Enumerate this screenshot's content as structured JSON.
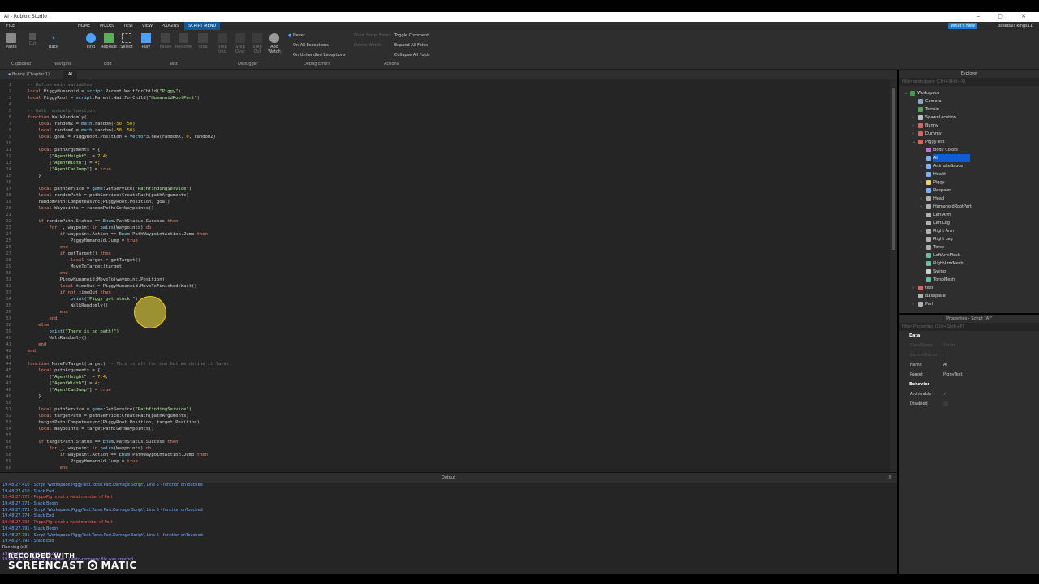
{
  "window": {
    "title": "AI - Roblox Studio",
    "controls": "– ▢ ✕"
  },
  "menubar": {
    "file": "FILE",
    "items": [
      "HOME",
      "MODEL",
      "TEST",
      "VIEW",
      "PLUGINS",
      "SCRIPT MENU"
    ],
    "whats_new": "What's New",
    "user": "baseball_kings11"
  },
  "ribbon": {
    "buttons": [
      "Paste",
      "Cut",
      "Copy",
      "Back",
      "Find",
      "Replace",
      "Select",
      "Play",
      "Pause",
      "Resume",
      "Stop",
      "Step Into",
      "Step Over",
      "Step Out",
      "Add Watch"
    ],
    "groups": [
      "Clipboard",
      "Navigate",
      "Edit",
      "Test",
      "Debugger",
      "Debug Errors",
      "Actions"
    ],
    "debug_errors": [
      "Never",
      "On All Exceptions",
      "On Unhandled Exceptions"
    ],
    "actions_dim": [
      "Show Script Errors",
      "Delete Watch"
    ],
    "actions": [
      "Toggle Comment",
      "Expand All Folds",
      "Collapse All Folds"
    ]
  },
  "tabs": [
    "Bunny (Chapter 1)",
    "AI"
  ],
  "code": {
    "lines": [
      [
        [
          "cm",
          "-- Define main variables"
        ]
      ],
      [
        [
          "kw",
          "local "
        ],
        [
          "",
          "PiggyHumanoid = "
        ],
        [
          "bi",
          "script"
        ],
        [
          "",
          ".Parent:WaitForChild("
        ],
        [
          "st",
          "\"Piggy\""
        ],
        [
          "",
          ")"
        ]
      ],
      [
        [
          "kw",
          "local "
        ],
        [
          "",
          "PiggyRoot = "
        ],
        [
          "bi",
          "script"
        ],
        [
          "",
          ".Parent:WaitForChild("
        ],
        [
          "st",
          "\"HumanoidRootPart\""
        ],
        [
          "",
          ")"
        ]
      ],
      [
        [
          "",
          ""
        ]
      ],
      [
        [
          "cm",
          "-- Walk randomly function"
        ]
      ],
      [
        [
          "kw",
          "function "
        ],
        [
          "",
          "WalkRandomly()"
        ]
      ],
      [
        [
          "",
          "    "
        ],
        [
          "kw",
          "local "
        ],
        [
          "",
          "randomZ = "
        ],
        [
          "bi",
          "math"
        ],
        [
          "",
          ".random(-"
        ],
        [
          "nm",
          "50"
        ],
        [
          "",
          ", "
        ],
        [
          "nm",
          "50"
        ],
        [
          "",
          ")"
        ]
      ],
      [
        [
          "",
          "    "
        ],
        [
          "kw",
          "local "
        ],
        [
          "",
          "randomX = "
        ],
        [
          "bi",
          "math"
        ],
        [
          "",
          ".random(-"
        ],
        [
          "nm",
          "50"
        ],
        [
          "",
          ", "
        ],
        [
          "nm",
          "50"
        ],
        [
          "",
          ")"
        ]
      ],
      [
        [
          "",
          "    "
        ],
        [
          "kw",
          "local "
        ],
        [
          "",
          "goal = PiggyRoot.Position + "
        ],
        [
          "bi",
          "Vector3"
        ],
        [
          "",
          ".new(randomX, "
        ],
        [
          "nm",
          "0"
        ],
        [
          "",
          ", randomZ)"
        ]
      ],
      [
        [
          "",
          ""
        ]
      ],
      [
        [
          "",
          "    "
        ],
        [
          "kw",
          "local "
        ],
        [
          "",
          "pathArguments = {"
        ]
      ],
      [
        [
          "",
          "        ["
        ],
        [
          "st",
          "\"AgentHeight\""
        ],
        [
          "",
          "] = "
        ],
        [
          "nm",
          "7.4"
        ],
        [
          "",
          ";"
        ]
      ],
      [
        [
          "",
          "        ["
        ],
        [
          "st",
          "\"AgentWidth\""
        ],
        [
          "",
          "] = "
        ],
        [
          "nm",
          "4"
        ],
        [
          "",
          ";"
        ]
      ],
      [
        [
          "",
          "        ["
        ],
        [
          "st",
          "\"AgentCanJump\""
        ],
        [
          "",
          "] = "
        ],
        [
          "kw",
          "true"
        ]
      ],
      [
        [
          "",
          "    }"
        ]
      ],
      [
        [
          "",
          ""
        ]
      ],
      [
        [
          "",
          "    "
        ],
        [
          "kw",
          "local "
        ],
        [
          "",
          "pathService = "
        ],
        [
          "bi",
          "game"
        ],
        [
          "",
          ":GetService("
        ],
        [
          "st",
          "\"PathfindingService\""
        ],
        [
          "",
          ")"
        ]
      ],
      [
        [
          "",
          "    "
        ],
        [
          "kw",
          "local "
        ],
        [
          "",
          "randomPath = pathService:CreatePath(pathArguments)"
        ]
      ],
      [
        [
          "",
          "    randomPath:ComputeAsync(PiggyRoot.Position, goal)"
        ]
      ],
      [
        [
          "",
          "    "
        ],
        [
          "kw",
          "local "
        ],
        [
          "",
          "Waypoints = randomPath:GetWaypoints()"
        ]
      ],
      [
        [
          "",
          ""
        ]
      ],
      [
        [
          "",
          "    "
        ],
        [
          "kw",
          "if "
        ],
        [
          "",
          "randomPath.Status == "
        ],
        [
          "bi",
          "Enum"
        ],
        [
          "",
          ".PathStatus.Success "
        ],
        [
          "kw",
          "then"
        ]
      ],
      [
        [
          "",
          "        "
        ],
        [
          "kw",
          "for "
        ],
        [
          "",
          "_, waypoint "
        ],
        [
          "kw",
          "in "
        ],
        [
          "bi",
          "pairs"
        ],
        [
          "",
          "(Waypoints) "
        ],
        [
          "kw",
          "do"
        ]
      ],
      [
        [
          "",
          "            "
        ],
        [
          "kw",
          "if "
        ],
        [
          "",
          "waypoint.Action == "
        ],
        [
          "bi",
          "Enum"
        ],
        [
          "",
          ".PathWaypointAction.Jump "
        ],
        [
          "kw",
          "then"
        ]
      ],
      [
        [
          "",
          "                PiggyHumanoid.Jump = "
        ],
        [
          "kw",
          "true"
        ]
      ],
      [
        [
          "",
          "            "
        ],
        [
          "kw",
          "end"
        ]
      ],
      [
        [
          "",
          "            "
        ],
        [
          "kw",
          "if "
        ],
        [
          "",
          "getTarget() "
        ],
        [
          "kw",
          "then"
        ]
      ],
      [
        [
          "",
          "                "
        ],
        [
          "kw",
          "local "
        ],
        [
          "",
          "target = getTarget()"
        ]
      ],
      [
        [
          "",
          "                MoveToTarget(target)"
        ]
      ],
      [
        [
          "",
          "            "
        ],
        [
          "kw",
          "end"
        ]
      ],
      [
        [
          "",
          "            PiggyHumanoid:MoveTo(waypoint.Position)"
        ]
      ],
      [
        [
          "",
          "            "
        ],
        [
          "kw",
          "local "
        ],
        [
          "",
          "timeOut = PiggyHumanoid.MoveToFinished:Wait()"
        ]
      ],
      [
        [
          "",
          "            "
        ],
        [
          "kw",
          "if not "
        ],
        [
          "",
          "timeOut "
        ],
        [
          "kw",
          "then"
        ]
      ],
      [
        [
          "",
          "                "
        ],
        [
          "bi",
          "print"
        ],
        [
          "",
          "("
        ],
        [
          "st",
          "\"Piggy got stuck!\""
        ],
        [
          "",
          ")"
        ]
      ],
      [
        [
          "",
          "                WalkRandomly()"
        ]
      ],
      [
        [
          "",
          "            "
        ],
        [
          "kw",
          "end"
        ]
      ],
      [
        [
          "",
          "        "
        ],
        [
          "kw",
          "end"
        ]
      ],
      [
        [
          "",
          "    "
        ],
        [
          "kw",
          "else"
        ]
      ],
      [
        [
          "",
          "        "
        ],
        [
          "bi",
          "print"
        ],
        [
          "",
          "("
        ],
        [
          "st",
          "\"There is no path!\""
        ],
        [
          "",
          ")"
        ]
      ],
      [
        [
          "",
          "        WalkRandomly()"
        ]
      ],
      [
        [
          "",
          "    "
        ],
        [
          "kw",
          "end"
        ]
      ],
      [
        [
          "kw",
          "end"
        ]
      ],
      [
        [
          "",
          ""
        ]
      ],
      [
        [
          "kw",
          "function "
        ],
        [
          "",
          "MoveToTarget(target) "
        ],
        [
          "cm",
          "-- This is all for now but we define it later."
        ]
      ],
      [
        [
          "",
          "    "
        ],
        [
          "kw",
          "local "
        ],
        [
          "",
          "pathArguments = {"
        ]
      ],
      [
        [
          "",
          "        ["
        ],
        [
          "st",
          "\"AgentHeight\""
        ],
        [
          "",
          "] = "
        ],
        [
          "nm",
          "7.4"
        ],
        [
          "",
          ";"
        ]
      ],
      [
        [
          "",
          "        ["
        ],
        [
          "st",
          "\"AgentWidth\""
        ],
        [
          "",
          "] = "
        ],
        [
          "nm",
          "4"
        ],
        [
          "",
          ";"
        ]
      ],
      [
        [
          "",
          "        ["
        ],
        [
          "st",
          "\"AgentCanJump\""
        ],
        [
          "",
          "] = "
        ],
        [
          "kw",
          "true"
        ]
      ],
      [
        [
          "",
          "    }"
        ]
      ],
      [
        [
          "",
          ""
        ]
      ],
      [
        [
          "",
          "    "
        ],
        [
          "kw",
          "local "
        ],
        [
          "",
          "pathService = "
        ],
        [
          "bi",
          "game"
        ],
        [
          "",
          ":GetService("
        ],
        [
          "st",
          "\"PathfindingService\""
        ],
        [
          "",
          ")"
        ]
      ],
      [
        [
          "",
          "    "
        ],
        [
          "kw",
          "local "
        ],
        [
          "",
          "targetPath = pathService:CreatePath(pathArguments)"
        ]
      ],
      [
        [
          "",
          "    targetPath:ComputeAsync(PiggyRoot.Position, target.Position)"
        ]
      ],
      [
        [
          "",
          "    "
        ],
        [
          "kw",
          "local "
        ],
        [
          "",
          "Waypoints = targetPath:GetWaypoints()"
        ]
      ],
      [
        [
          "",
          ""
        ]
      ],
      [
        [
          "",
          "    "
        ],
        [
          "kw",
          "if "
        ],
        [
          "",
          "targetPath.Status == "
        ],
        [
          "bi",
          "Enum"
        ],
        [
          "",
          ".PathStatus.Success "
        ],
        [
          "kw",
          "then"
        ]
      ],
      [
        [
          "",
          "        "
        ],
        [
          "kw",
          "for "
        ],
        [
          "",
          "_, waypoint "
        ],
        [
          "kw",
          "in "
        ],
        [
          "bi",
          "pairs"
        ],
        [
          "",
          "(Waypoints) "
        ],
        [
          "kw",
          "do"
        ]
      ],
      [
        [
          "",
          "            "
        ],
        [
          "kw",
          "if "
        ],
        [
          "",
          "waypoint.Action == "
        ],
        [
          "bi",
          "Enum"
        ],
        [
          "",
          ".PathWaypointAction.Jump "
        ],
        [
          "kw",
          "then"
        ]
      ],
      [
        [
          "",
          "                PiggyHumanoid.Jump = "
        ],
        [
          "kw",
          "true"
        ]
      ],
      [
        [
          "",
          "            "
        ],
        [
          "kw",
          "end"
        ]
      ]
    ]
  },
  "output": {
    "title": "Output",
    "lines": [
      {
        "kind": "info",
        "text": "19:48:27.410 - Script 'Workspace.PiggyTest.Torso.Part.Damage Script', Line 5 - function onTouched"
      },
      {
        "kind": "info",
        "text": "19:48:27.410 - Stack End"
      },
      {
        "kind": "err",
        "text": "19:48:27.773 - PeppaPig is not a valid member of Part"
      },
      {
        "kind": "info",
        "text": "19:48:27.773 - Stack Begin"
      },
      {
        "kind": "info",
        "text": "19:48:27.773 - Script 'Workspace.PiggyTest.Torso.Part.Damage Script', Line 5 - function onTouched"
      },
      {
        "kind": "info",
        "text": "19:48:27.774 - Stack End"
      },
      {
        "kind": "err",
        "text": "19:48:27.790 - PeppaPig is not a valid member of Part"
      },
      {
        "kind": "info",
        "text": "19:48:27.791 - Stack Begin"
      },
      {
        "kind": "info",
        "text": "19:48:27.791 - Script 'Workspace.PiggyTest.Torso.Part.Damage Script', Line 5 - function onTouched"
      },
      {
        "kind": "info",
        "text": "19:48:27.792 - Stack End"
      },
      {
        "kind": "plain",
        "text": "Running (x3)"
      },
      {
        "kind": "purple",
        "text": "19:48:28.9?? - ???:: 195229"
      },
      {
        "kind": "purple",
        "text": "19:48:28.??? - Bunny (Chapter 1) auto-recovery file was created"
      }
    ]
  },
  "explorer": {
    "title": "Explorer",
    "filter": "Filter workspace (Ctrl+Shift+X)",
    "items": [
      {
        "label": "Workspace",
        "depth": 0,
        "color": "#3ea14a",
        "open": true
      },
      {
        "label": "Camera",
        "depth": 1,
        "color": "#8aa6c8"
      },
      {
        "label": "Terrain",
        "depth": 1,
        "color": "#5aa05a"
      },
      {
        "label": "SpawnLocation",
        "depth": 1,
        "color": "#c0c0c0",
        "arrow": true
      },
      {
        "label": "Bunny",
        "depth": 1,
        "color": "#e06060",
        "arrow": true
      },
      {
        "label": "Dummy",
        "depth": 1,
        "color": "#e06060",
        "arrow": true
      },
      {
        "label": "PiggyTest",
        "depth": 1,
        "color": "#e06060",
        "open": true
      },
      {
        "label": "Body Colors",
        "depth": 2,
        "color": "#c070d0"
      },
      {
        "label": "AI",
        "depth": 2,
        "color": "#7ab0ff",
        "selected": true
      },
      {
        "label": "AnimateSauce",
        "depth": 2,
        "color": "#7ab0ff",
        "arrow": true
      },
      {
        "label": "Health",
        "depth": 2,
        "color": "#7ab0ff"
      },
      {
        "label": "Piggy",
        "depth": 2,
        "color": "#f0d060",
        "arrow": true
      },
      {
        "label": "Respawn",
        "depth": 2,
        "color": "#7ab0ff"
      },
      {
        "label": "Head",
        "depth": 2,
        "color": "#b0b0b0",
        "arrow": true
      },
      {
        "label": "HumanoidRootPart",
        "depth": 2,
        "color": "#b0b0b0",
        "arrow": true
      },
      {
        "label": "Left Arm",
        "depth": 2,
        "color": "#b0b0b0"
      },
      {
        "label": "Left Leg",
        "depth": 2,
        "color": "#b0b0b0"
      },
      {
        "label": "Right Arm",
        "depth": 2,
        "color": "#b0b0b0",
        "arrow": true
      },
      {
        "label": "Right Leg",
        "depth": 2,
        "color": "#b0b0b0"
      },
      {
        "label": "Torso",
        "depth": 2,
        "color": "#b0b0b0",
        "arrow": true
      },
      {
        "label": "LeftArmMesh",
        "depth": 2,
        "color": "#60c0a0"
      },
      {
        "label": "RightArmMesh",
        "depth": 2,
        "color": "#60c0a0"
      },
      {
        "label": "Swing",
        "depth": 2,
        "color": "#d0d0d0"
      },
      {
        "label": "TorsoMesh",
        "depth": 2,
        "color": "#60c0a0"
      },
      {
        "label": "test",
        "depth": 1,
        "color": "#e06060",
        "arrow": true
      },
      {
        "label": "Baseplate",
        "depth": 1,
        "color": "#b0b0b0"
      },
      {
        "label": "Part",
        "depth": 1,
        "color": "#b0b0b0",
        "arrow": true
      }
    ]
  },
  "properties": {
    "title": "Properties - Script \"AI\"",
    "filter": "Filter Properties (Ctrl+Shift+P)",
    "section_data": "Data",
    "dim_rows": [
      {
        "key": "ClassName",
        "value": "Script"
      },
      {
        "key": "CurrentEditor",
        "value": ""
      }
    ],
    "rows": [
      {
        "key": "Name",
        "value": "AI"
      },
      {
        "key": "Parent",
        "value": "PiggyTest"
      }
    ],
    "section_behavior": "Behavior",
    "behavior_rows": [
      {
        "key": "Archivable",
        "value": "✓"
      },
      {
        "key": "Disabled",
        "value": ""
      }
    ]
  },
  "watermark": {
    "line1": "RECORDED WITH",
    "line2a": "SCREENCAST",
    "line2b": "MATIC"
  }
}
